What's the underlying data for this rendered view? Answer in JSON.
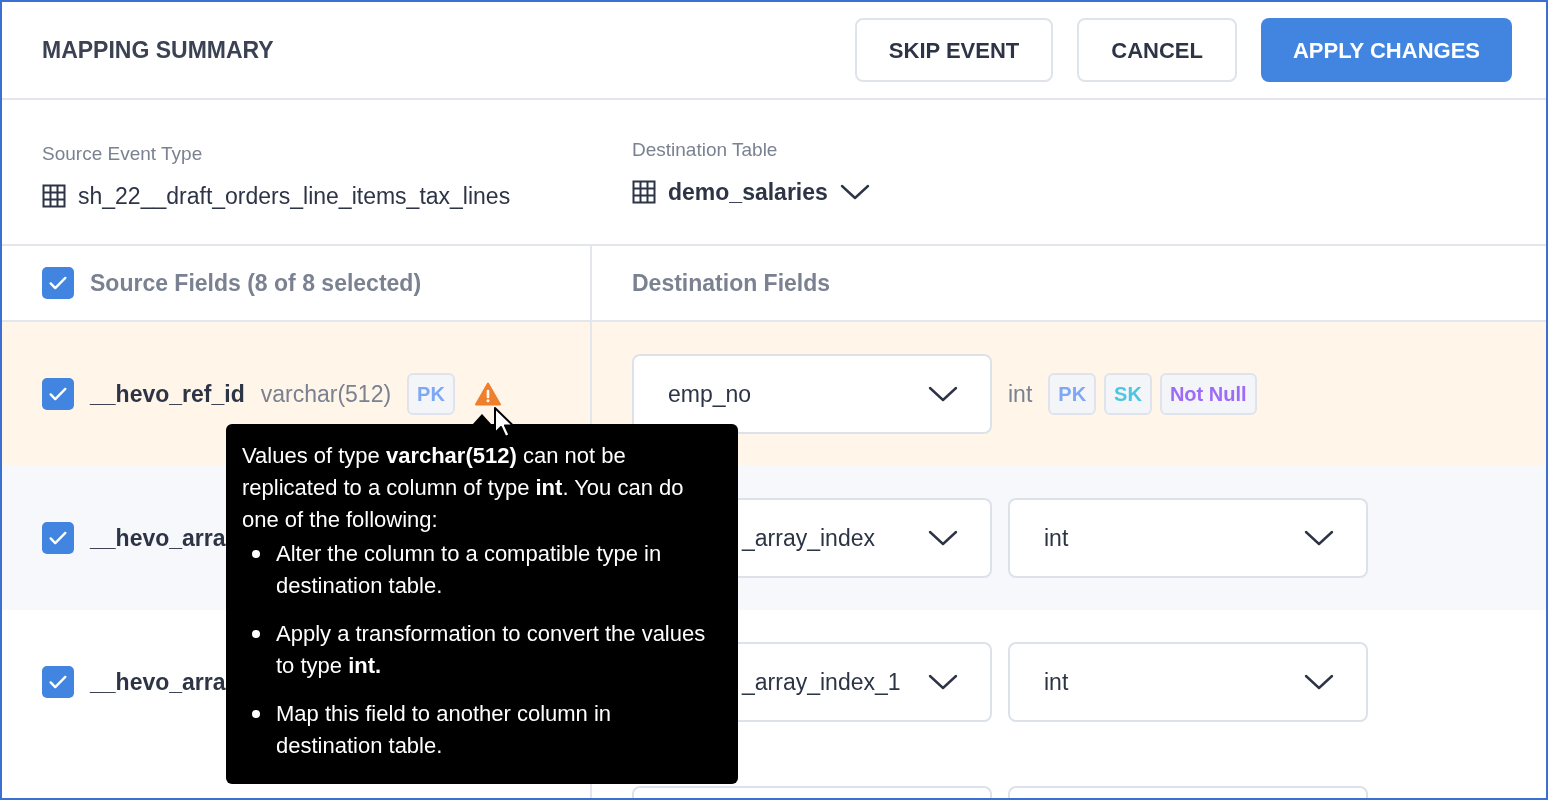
{
  "header": {
    "title": "MAPPING SUMMARY",
    "buttons": [
      {
        "label": "SKIP EVENT",
        "kind": "secondary"
      },
      {
        "label": "CANCEL",
        "kind": "secondary"
      },
      {
        "label": "APPLY CHANGES",
        "kind": "primary"
      }
    ]
  },
  "source": {
    "label": "Source Event Type",
    "value": "sh_22__draft_orders_line_items_tax_lines"
  },
  "destination": {
    "label": "Destination Table",
    "value": "demo_salaries"
  },
  "columns": {
    "source": {
      "label": "Source Fields (8 of 8 selected)",
      "checked": true
    },
    "destination": {
      "label": "Destination Fields"
    }
  },
  "rows": [
    {
      "checked": true,
      "highlighted": true,
      "name": "__hevo_ref_id",
      "type": "varchar(512)",
      "badges": [
        {
          "label": "PK",
          "color": "#7ea8f3"
        }
      ],
      "warning": true,
      "destination": {
        "kind": "fixed",
        "value": "emp_no",
        "type": "int",
        "badges": [
          {
            "label": "PK",
            "color": "#7ea8f3"
          },
          {
            "label": "SK",
            "color": "#4cc6e2"
          },
          {
            "label": "Not Null",
            "color": "#9d6cf7"
          }
        ]
      }
    },
    {
      "checked": true,
      "highlighted": false,
      "name": "__hevo_arra",
      "warning": false,
      "destination": {
        "kind": "select",
        "value": "_array_index",
        "type": "int"
      }
    },
    {
      "checked": true,
      "highlighted": false,
      "name": "__hevo_arra",
      "warning": false,
      "destination": {
        "kind": "select",
        "value": "_array_index_1",
        "type": "int"
      }
    }
  ],
  "more_rows_below": true,
  "tooltip": {
    "intro": "Values of type **varchar(512)** can not be replicated to a column of type **int**. You can do one of the following:",
    "items": [
      "Alter the column to a compatible type in destination table.",
      "Apply a transformation to convert the values to type **int.**",
      "Map this field to another column in destination table."
    ]
  }
}
